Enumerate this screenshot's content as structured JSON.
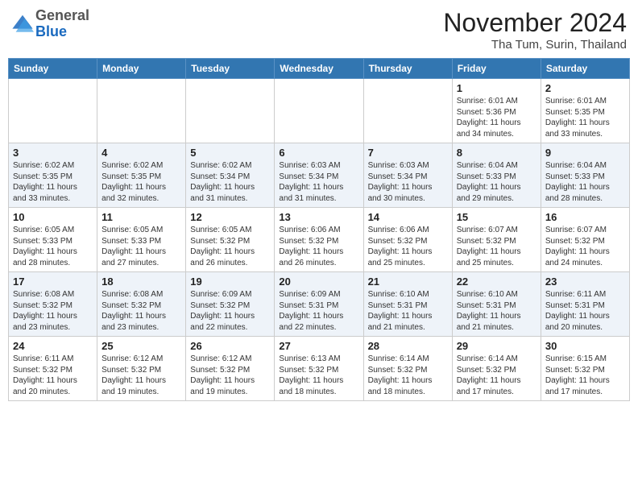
{
  "header": {
    "logo_line1": "General",
    "logo_line2": "Blue",
    "month": "November 2024",
    "location": "Tha Tum, Surin, Thailand"
  },
  "weekdays": [
    "Sunday",
    "Monday",
    "Tuesday",
    "Wednesday",
    "Thursday",
    "Friday",
    "Saturday"
  ],
  "weeks": [
    [
      {
        "day": "",
        "info": ""
      },
      {
        "day": "",
        "info": ""
      },
      {
        "day": "",
        "info": ""
      },
      {
        "day": "",
        "info": ""
      },
      {
        "day": "",
        "info": ""
      },
      {
        "day": "1",
        "info": "Sunrise: 6:01 AM\nSunset: 5:36 PM\nDaylight: 11 hours\nand 34 minutes."
      },
      {
        "day": "2",
        "info": "Sunrise: 6:01 AM\nSunset: 5:35 PM\nDaylight: 11 hours\nand 33 minutes."
      }
    ],
    [
      {
        "day": "3",
        "info": "Sunrise: 6:02 AM\nSunset: 5:35 PM\nDaylight: 11 hours\nand 33 minutes."
      },
      {
        "day": "4",
        "info": "Sunrise: 6:02 AM\nSunset: 5:35 PM\nDaylight: 11 hours\nand 32 minutes."
      },
      {
        "day": "5",
        "info": "Sunrise: 6:02 AM\nSunset: 5:34 PM\nDaylight: 11 hours\nand 31 minutes."
      },
      {
        "day": "6",
        "info": "Sunrise: 6:03 AM\nSunset: 5:34 PM\nDaylight: 11 hours\nand 31 minutes."
      },
      {
        "day": "7",
        "info": "Sunrise: 6:03 AM\nSunset: 5:34 PM\nDaylight: 11 hours\nand 30 minutes."
      },
      {
        "day": "8",
        "info": "Sunrise: 6:04 AM\nSunset: 5:33 PM\nDaylight: 11 hours\nand 29 minutes."
      },
      {
        "day": "9",
        "info": "Sunrise: 6:04 AM\nSunset: 5:33 PM\nDaylight: 11 hours\nand 28 minutes."
      }
    ],
    [
      {
        "day": "10",
        "info": "Sunrise: 6:05 AM\nSunset: 5:33 PM\nDaylight: 11 hours\nand 28 minutes."
      },
      {
        "day": "11",
        "info": "Sunrise: 6:05 AM\nSunset: 5:33 PM\nDaylight: 11 hours\nand 27 minutes."
      },
      {
        "day": "12",
        "info": "Sunrise: 6:05 AM\nSunset: 5:32 PM\nDaylight: 11 hours\nand 26 minutes."
      },
      {
        "day": "13",
        "info": "Sunrise: 6:06 AM\nSunset: 5:32 PM\nDaylight: 11 hours\nand 26 minutes."
      },
      {
        "day": "14",
        "info": "Sunrise: 6:06 AM\nSunset: 5:32 PM\nDaylight: 11 hours\nand 25 minutes."
      },
      {
        "day": "15",
        "info": "Sunrise: 6:07 AM\nSunset: 5:32 PM\nDaylight: 11 hours\nand 25 minutes."
      },
      {
        "day": "16",
        "info": "Sunrise: 6:07 AM\nSunset: 5:32 PM\nDaylight: 11 hours\nand 24 minutes."
      }
    ],
    [
      {
        "day": "17",
        "info": "Sunrise: 6:08 AM\nSunset: 5:32 PM\nDaylight: 11 hours\nand 23 minutes."
      },
      {
        "day": "18",
        "info": "Sunrise: 6:08 AM\nSunset: 5:32 PM\nDaylight: 11 hours\nand 23 minutes."
      },
      {
        "day": "19",
        "info": "Sunrise: 6:09 AM\nSunset: 5:32 PM\nDaylight: 11 hours\nand 22 minutes."
      },
      {
        "day": "20",
        "info": "Sunrise: 6:09 AM\nSunset: 5:31 PM\nDaylight: 11 hours\nand 22 minutes."
      },
      {
        "day": "21",
        "info": "Sunrise: 6:10 AM\nSunset: 5:31 PM\nDaylight: 11 hours\nand 21 minutes."
      },
      {
        "day": "22",
        "info": "Sunrise: 6:10 AM\nSunset: 5:31 PM\nDaylight: 11 hours\nand 21 minutes."
      },
      {
        "day": "23",
        "info": "Sunrise: 6:11 AM\nSunset: 5:31 PM\nDaylight: 11 hours\nand 20 minutes."
      }
    ],
    [
      {
        "day": "24",
        "info": "Sunrise: 6:11 AM\nSunset: 5:32 PM\nDaylight: 11 hours\nand 20 minutes."
      },
      {
        "day": "25",
        "info": "Sunrise: 6:12 AM\nSunset: 5:32 PM\nDaylight: 11 hours\nand 19 minutes."
      },
      {
        "day": "26",
        "info": "Sunrise: 6:12 AM\nSunset: 5:32 PM\nDaylight: 11 hours\nand 19 minutes."
      },
      {
        "day": "27",
        "info": "Sunrise: 6:13 AM\nSunset: 5:32 PM\nDaylight: 11 hours\nand 18 minutes."
      },
      {
        "day": "28",
        "info": "Sunrise: 6:14 AM\nSunset: 5:32 PM\nDaylight: 11 hours\nand 18 minutes."
      },
      {
        "day": "29",
        "info": "Sunrise: 6:14 AM\nSunset: 5:32 PM\nDaylight: 11 hours\nand 17 minutes."
      },
      {
        "day": "30",
        "info": "Sunrise: 6:15 AM\nSunset: 5:32 PM\nDaylight: 11 hours\nand 17 minutes."
      }
    ]
  ]
}
